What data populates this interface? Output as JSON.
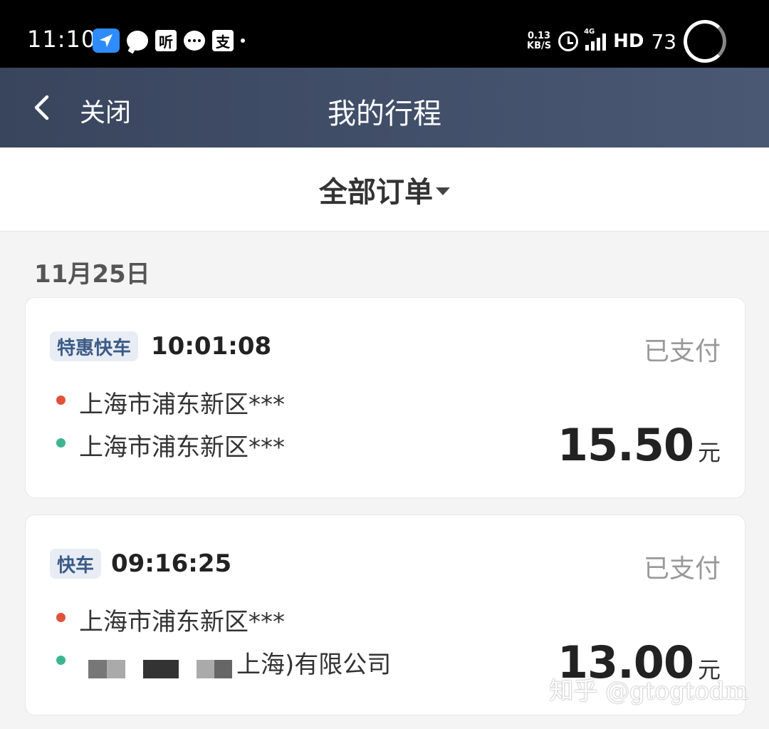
{
  "statusbar": {
    "time": "11:10",
    "app_ting": "听",
    "app_zhi": "支",
    "speed_value": "0.13",
    "speed_unit": "KB/S",
    "network": "4G",
    "hd": "HD",
    "battery": "73"
  },
  "header": {
    "close_label": "关闭",
    "title": "我的行程"
  },
  "filter": {
    "label": "全部订单"
  },
  "date_group": "11月25日",
  "trips": [
    {
      "type": "特惠快车",
      "time": "10:01:08",
      "status": "已支付",
      "start": "上海市浦东新区***",
      "end": "上海市浦东新区***",
      "amount": "15.50",
      "unit": "元"
    },
    {
      "type": "快车",
      "time": "09:16:25",
      "status": "已支付",
      "start": "上海市浦东新区***",
      "end": "上海)有限公司",
      "amount": "13.00",
      "unit": "元"
    }
  ],
  "watermark": "知乎 @gtogtodm",
  "colors": {
    "header_bg": "#3f4c66",
    "badge_bg": "#e8edf5",
    "badge_text": "#3b5a86",
    "start_dot": "#e0533a",
    "end_dot": "#3db490",
    "status_text": "#999999"
  }
}
